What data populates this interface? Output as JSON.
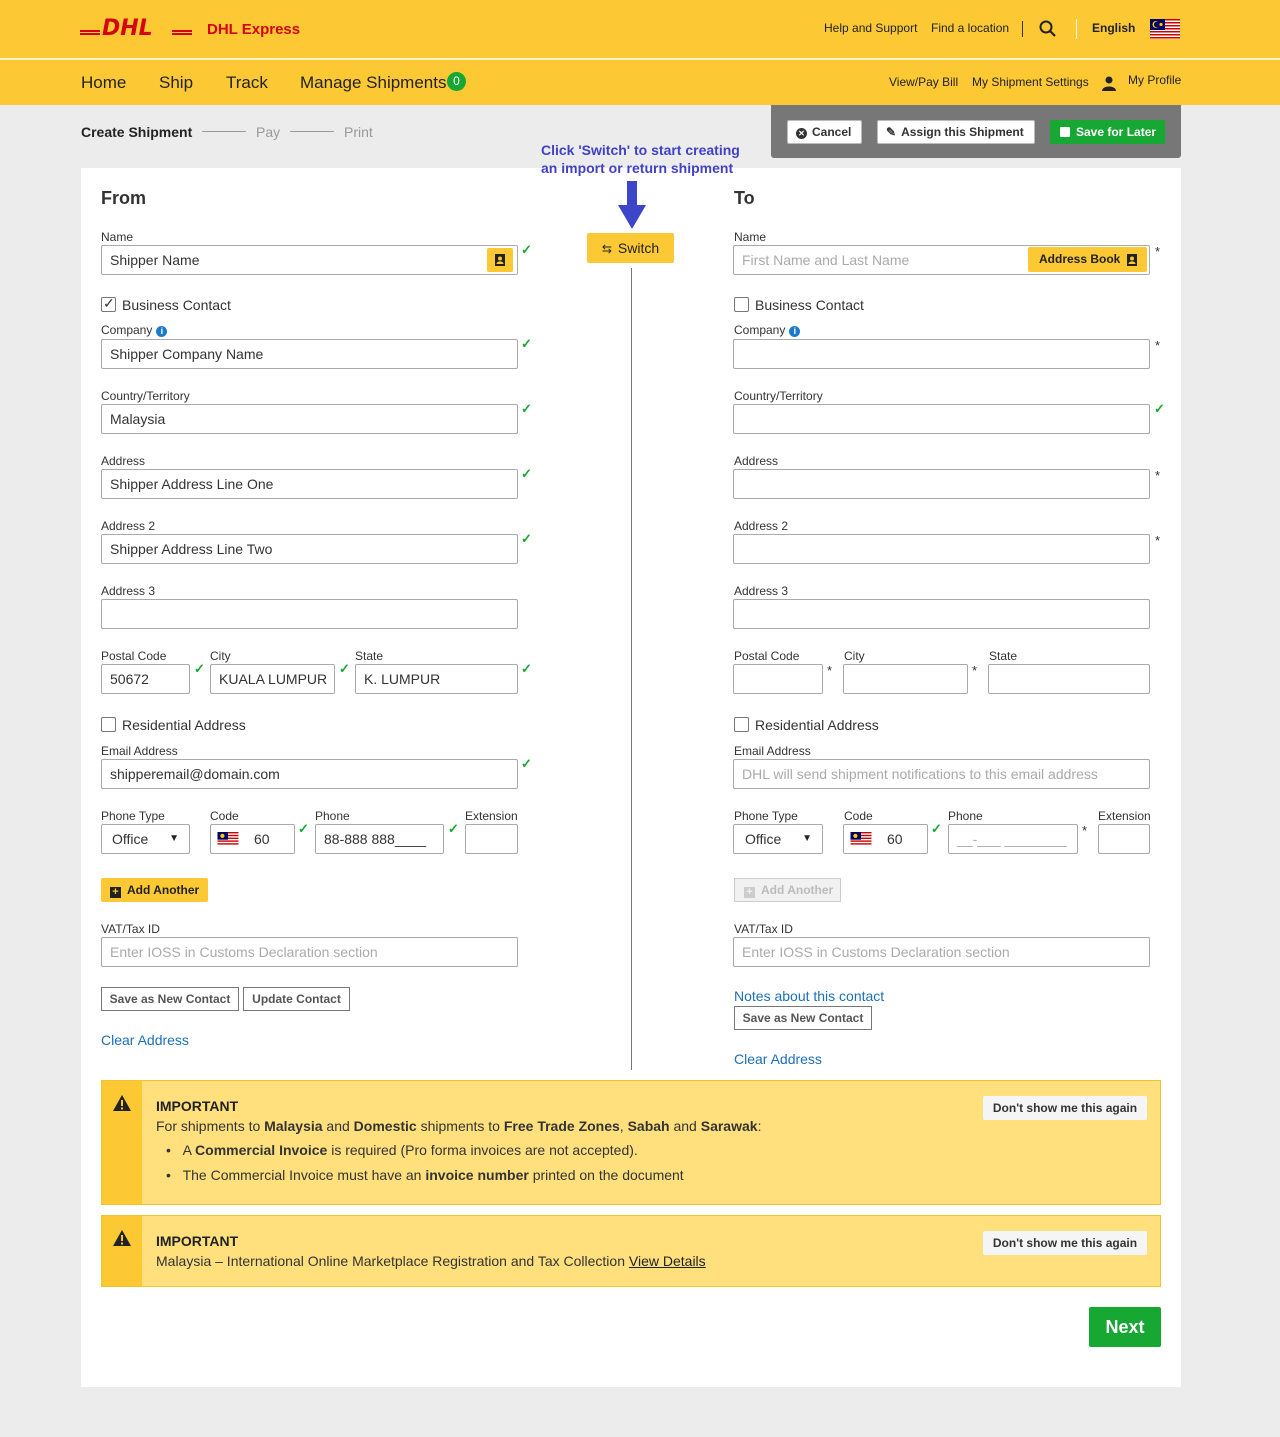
{
  "header": {
    "brand": "DHL Express",
    "logo_text": "DHL",
    "help": "Help and Support",
    "find_location": "Find a location",
    "language": "English"
  },
  "nav": {
    "home": "Home",
    "ship": "Ship",
    "track": "Track",
    "manage": "Manage Shipments",
    "manage_count": "0",
    "view_pay_bill": "View/Pay Bill",
    "shipment_settings": "My Shipment Settings",
    "profile": "My Profile"
  },
  "steps": {
    "create": "Create Shipment",
    "pay": "Pay",
    "print": "Print"
  },
  "actions": {
    "cancel": "Cancel",
    "assign": "Assign this Shipment",
    "save_later": "Save for Later"
  },
  "switch": {
    "note_line1": "Click 'Switch' to start creating",
    "note_line2": "an import or return shipment",
    "label": "Switch"
  },
  "from": {
    "title": "From",
    "name_label": "Name",
    "name_value": "Shipper Name",
    "business_contact": "Business Contact",
    "company_label": "Company",
    "company_value": "Shipper Company Name",
    "country_label": "Country/Territory",
    "country_value": "Malaysia",
    "address_label": "Address",
    "address_value": "Shipper Address Line One",
    "address2_label": "Address 2",
    "address2_value": "Shipper Address Line Two",
    "address3_label": "Address 3",
    "postal_label": "Postal Code",
    "postal_value": "50672",
    "city_label": "City",
    "city_value": "KUALA LUMPUR",
    "state_label": "State",
    "state_value": "K. LUMPUR",
    "residential": "Residential Address",
    "email_label": "Email Address",
    "email_value": "shipperemail@domain.com",
    "phone_type_label": "Phone Type",
    "phone_type_value": "Office",
    "code_label": "Code",
    "code_value": "60",
    "phone_label": "Phone",
    "phone_value": "88-888 888____",
    "extension_label": "Extension",
    "add_another": "Add Another",
    "vat_label": "VAT/Tax ID",
    "vat_placeholder": "Enter IOSS in Customs Declaration section",
    "save_new": "Save as New Contact",
    "update": "Update Contact",
    "clear": "Clear Address"
  },
  "to": {
    "title": "To",
    "name_label": "Name",
    "name_placeholder": "First Name and Last Name",
    "address_book": "Address Book",
    "business_contact": "Business Contact",
    "company_label": "Company",
    "country_label": "Country/Territory",
    "address_label": "Address",
    "address2_label": "Address 2",
    "address3_label": "Address 3",
    "postal_label": "Postal Code",
    "city_label": "City",
    "state_label": "State",
    "residential": "Residential Address",
    "email_label": "Email Address",
    "email_placeholder": "DHL will send shipment notifications to this email address",
    "phone_type_label": "Phone Type",
    "phone_type_value": "Office",
    "code_label": "Code",
    "code_value": "60",
    "phone_label": "Phone",
    "phone_placeholder": "__-___ ________",
    "extension_label": "Extension",
    "add_another": "Add Another",
    "vat_label": "VAT/Tax ID",
    "vat_placeholder": "Enter IOSS in Customs Declaration section",
    "notes": "Notes about this contact",
    "save_new": "Save as New Contact",
    "clear": "Clear Address"
  },
  "important1": {
    "title": "IMPORTANT",
    "dismiss": "Don't show me this again",
    "intro_1": "For shipments to ",
    "intro_malaysia": "Malaysia",
    "intro_2": " and ",
    "intro_domestic": "Domestic",
    "intro_3": " shipments to ",
    "intro_ftz": "Free Trade Zones",
    "intro_4": ", ",
    "intro_sabah": "Sabah",
    "intro_5": " and ",
    "intro_sarawak": "Sarawak",
    "intro_6": ":",
    "bullet1_a": "A ",
    "bullet1_b": "Commercial Invoice",
    "bullet1_c": " is required (Pro forma invoices are not accepted).",
    "bullet2_a": "The Commercial Invoice must have an ",
    "bullet2_b": "invoice number",
    "bullet2_c": " printed on the document"
  },
  "important2": {
    "title": "IMPORTANT",
    "dismiss": "Don't show me this again",
    "text": "Malaysia – International Online Marketplace Registration and Tax Collection ",
    "link": "View Details"
  },
  "next": "Next",
  "colors": {
    "dhl_yellow": "#fcc934",
    "dhl_red": "#d40511",
    "green": "#17a733",
    "link_blue": "#1c6fb8",
    "note_blue": "#4040c8"
  }
}
